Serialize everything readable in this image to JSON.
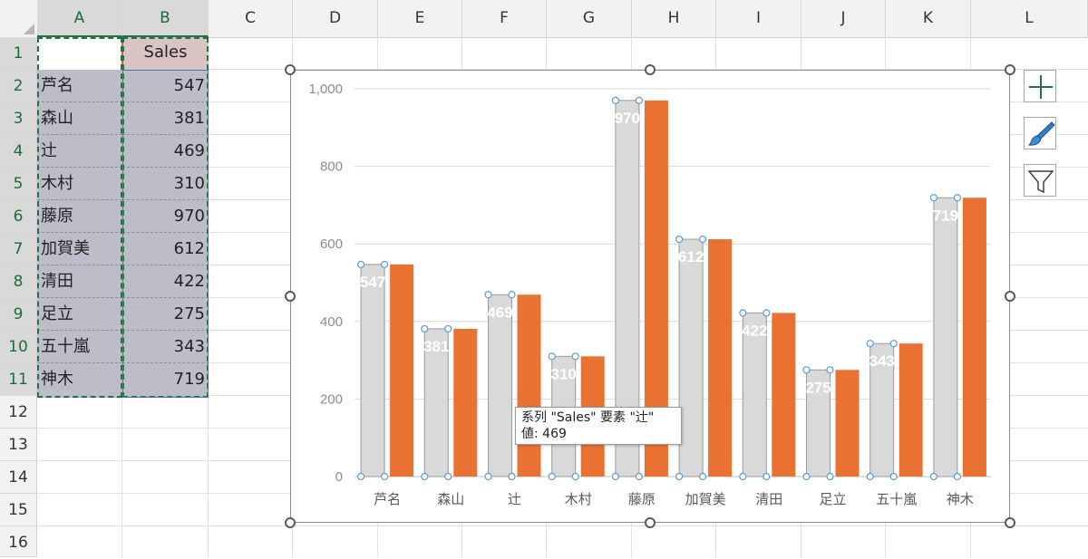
{
  "sheet": {
    "columns": [
      "A",
      "B",
      "C",
      "D",
      "E",
      "F",
      "G",
      "H",
      "I",
      "J",
      "K",
      "L"
    ],
    "rows": [
      "1",
      "2",
      "3",
      "4",
      "5",
      "6",
      "7",
      "8",
      "9",
      "10",
      "11",
      "12",
      "13",
      "14",
      "15",
      "16"
    ],
    "header_b": "Sales",
    "table": [
      {
        "name": "芦名",
        "value": "547"
      },
      {
        "name": "森山",
        "value": "381"
      },
      {
        "name": "辻",
        "value": "469"
      },
      {
        "name": "木村",
        "value": "310"
      },
      {
        "name": "藤原",
        "value": "970"
      },
      {
        "name": "加賀美",
        "value": "612"
      },
      {
        "name": "清田",
        "value": "422"
      },
      {
        "name": "足立",
        "value": "275"
      },
      {
        "name": "五十嵐",
        "value": "343"
      },
      {
        "name": "神木",
        "value": "719"
      }
    ]
  },
  "chart_data": {
    "type": "bar",
    "categories": [
      "芦名",
      "森山",
      "辻",
      "木村",
      "藤原",
      "加賀美",
      "清田",
      "足立",
      "五十嵐",
      "神木"
    ],
    "series": [
      {
        "values": [
          547,
          381,
          469,
          310,
          970,
          612,
          422,
          275,
          343,
          719
        ],
        "color": "#d9d9d9",
        "data_labels": true,
        "selected": true
      },
      {
        "values": [
          547,
          381,
          469,
          310,
          970,
          612,
          422,
          275,
          343,
          719
        ],
        "color": "#e97132",
        "data_labels": false
      }
    ],
    "yticks": [
      "0",
      "200",
      "400",
      "600",
      "800",
      "1,000"
    ],
    "ylim": [
      0,
      1000
    ],
    "grid": true,
    "title": "",
    "xlabel": "",
    "ylabel": ""
  },
  "tooltip": {
    "line1": "系列 \"Sales\" 要素 \"辻\"",
    "line2": "値: 469"
  },
  "side_buttons": [
    {
      "icon": "plus-icon"
    },
    {
      "icon": "brush-icon"
    },
    {
      "icon": "filter-icon"
    }
  ],
  "colors": {
    "accent": "#217346",
    "bar_gray": "#d9d9d9",
    "bar_orange": "#e97132",
    "selection_fill": "#bdbdc9"
  }
}
